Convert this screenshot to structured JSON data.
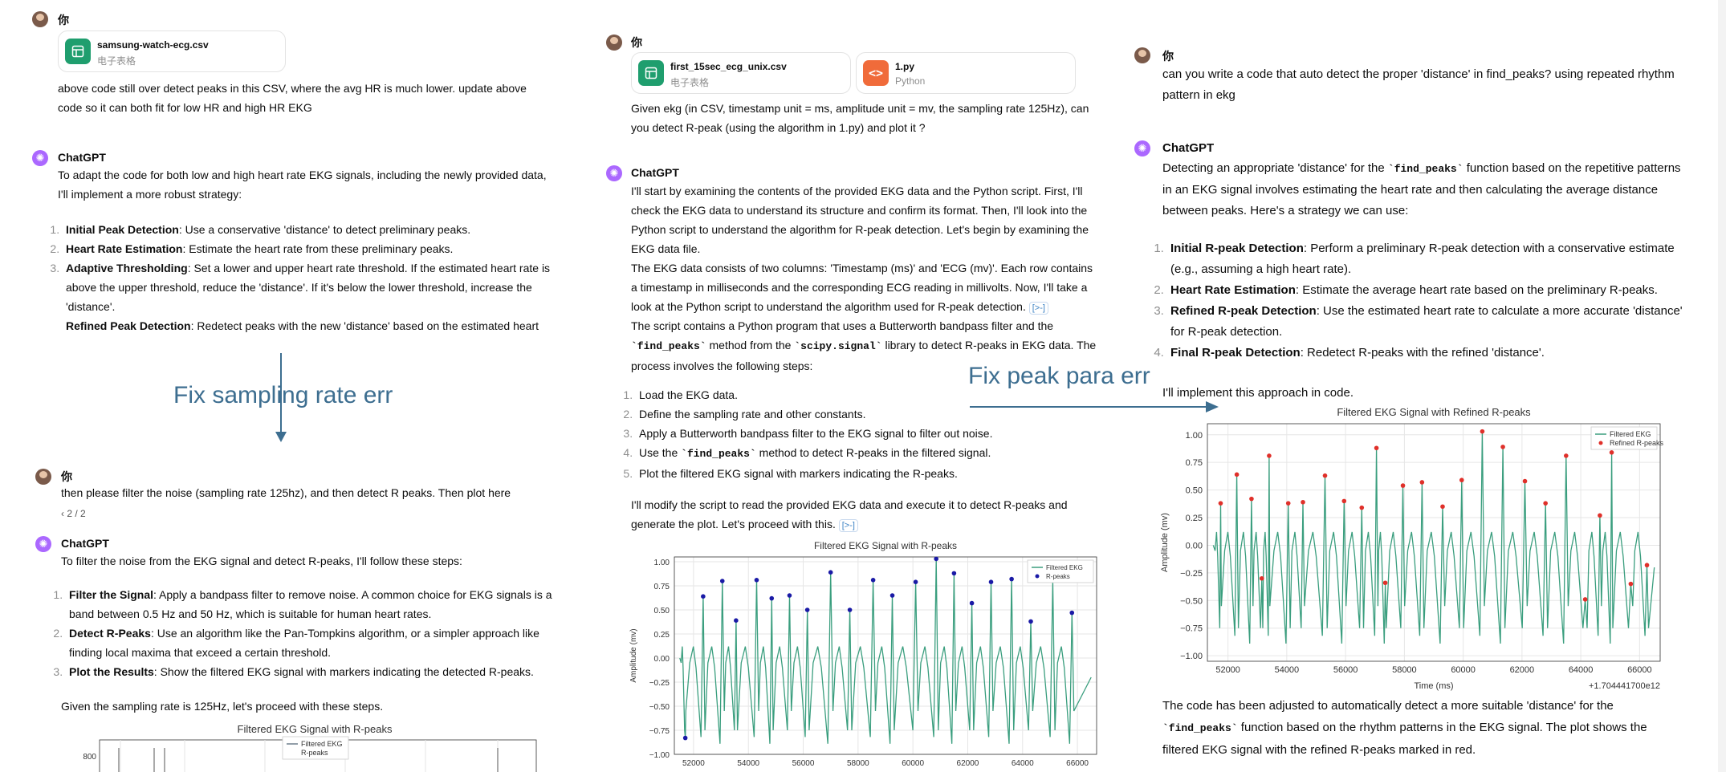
{
  "col1": {
    "user1_name": "你",
    "file1": {
      "name": "samsung-watch-ecg.csv",
      "type": "电子表格",
      "icon": "spreadsheet-icon",
      "color": "#1f9e6e"
    },
    "user1_text": "above code still over detect peaks in this CSV, where the avg HR is much lower. update above code so it can both fit for low HR and high HR EKG",
    "gpt1_name": "ChatGPT",
    "gpt1_intro": "To adapt the code for both low and high heart rate EKG signals, including the newly provided data, I'll implement a more robust strategy:",
    "gpt1_steps": [
      {
        "title": "Initial Peak Detection",
        "text": ": Use a conservative 'distance' to detect preliminary peaks."
      },
      {
        "title": "Heart Rate Estimation",
        "text": ": Estimate the heart rate from these preliminary peaks."
      },
      {
        "title": "Adaptive Thresholding",
        "text": ": Set a lower and upper heart rate threshold. If the estimated heart rate is above the upper threshold, reduce the 'distance'. If it's below the lower threshold, increase the 'distance'."
      },
      {
        "title": "Refined Peak Detection",
        "text": ": Redetect peaks with the new 'distance' based on the estimated heart rate."
      }
    ],
    "user2_name": "你",
    "user2_text": "then please filter the noise (sampling rate 125hz), and then detect R peaks. Then plot here",
    "pager": "2 / 2",
    "gpt2_name": "ChatGPT",
    "gpt2_intro": "To filter the noise from the EKG signal and detect R-peaks, I'll follow these steps:",
    "gpt2_steps": [
      {
        "title": "Filter the Signal",
        "text": ": Apply a bandpass filter to remove noise. A common choice for EKG signals is a band between 0.5 Hz and 50 Hz, which is suitable for human heart rates."
      },
      {
        "title": "Detect R-Peaks",
        "text": ": Use an algorithm like the Pan-Tompkins algorithm, or a simpler approach like finding local maxima that exceed a certain threshold."
      },
      {
        "title": "Plot the Results",
        "text": ": Show the filtered EKG signal with markers indicating the detected R-peaks."
      }
    ],
    "gpt2_outro": "Given the sampling rate is 125Hz, let's proceed with these steps."
  },
  "col2": {
    "user_name": "你",
    "file1": {
      "name": "first_15sec_ecg_unix.csv",
      "type": "电子表格",
      "icon": "spreadsheet-icon",
      "color": "#1f9e6e"
    },
    "file2": {
      "name": "1.py",
      "type": "Python",
      "icon": "code-icon",
      "color": "#f06b3a"
    },
    "user_text": "Given ekg (in CSV, timestamp unit = ms, amplitude unit = mv, the sampling rate 125Hz), can you detect R-peak (using the algorithm in 1.py) and plot it ?",
    "gpt_name": "ChatGPT",
    "para1": "I'll start by examining the contents of the provided EKG data and the Python script. First, I'll check the EKG data to understand its structure and confirm its format. Then, I'll look into the Python script to understand the algorithm for R-peak detection. Let's begin by examining the EKG data file.",
    "para2": "The EKG data consists of two columns: 'Timestamp (ms)' and 'ECG (mv)'. Each row contains a timestamp in milliseconds and the corresponding ECG reading in millivolts. Now, I'll take a look at the Python script to understand the algorithm used for R-peak detection.",
    "link_badge": "[>-]",
    "para3_a": "The script contains a Python program that uses a Butterworth bandpass filter and the",
    "para3_code1": "`find_peaks`",
    "para3_b": " method from the ",
    "para3_code2": "`scipy.signal`",
    "para3_c": " library to detect R-peaks in EKG data. The process involves the following steps:",
    "steps": [
      {
        "a": "Load the EKG data.",
        "code": "",
        "b": ""
      },
      {
        "a": "Define the sampling rate and other constants.",
        "code": "",
        "b": ""
      },
      {
        "a": "Apply a Butterworth bandpass filter to the EKG signal to filter out noise.",
        "code": "",
        "b": ""
      },
      {
        "a": "Use the ",
        "code": "`find_peaks`",
        "b": " method to detect R-peaks in the filtered signal."
      },
      {
        "a": "Plot the filtered EKG signal with markers indicating the R-peaks.",
        "code": "",
        "b": ""
      }
    ],
    "para4": "I'll modify the script to read the provided EKG data and execute it to detect R-peaks and generate the plot. Let's proceed with this."
  },
  "col3": {
    "user_name": "你",
    "user_text": "can you write a code that auto detect the proper 'distance' in find_peaks? using repeated rhythm pattern in ekg",
    "gpt_name": "ChatGPT",
    "intro_a": "Detecting an appropriate 'distance' for the ",
    "intro_code": "`find_peaks`",
    "intro_b": " function based on the repetitive patterns in an EKG signal involves estimating the heart rate and then calculating the average distance between peaks. Here's a strategy we can use:",
    "steps": [
      {
        "title": "Initial R-peak Detection",
        "text": ": Perform a preliminary R-peak detection with a conservative estimate (e.g., assuming a high heart rate)."
      },
      {
        "title": "Heart Rate Estimation",
        "text": ": Estimate the average heart rate based on the preliminary R-peaks."
      },
      {
        "title": "Refined R-peak Detection",
        "text": ": Use the estimated heart rate to calculate a more accurate 'distance' for R-peak detection."
      },
      {
        "title": "Final R-peak Detection",
        "text": ": Redetect R-peaks with the refined 'distance'."
      }
    ],
    "implement": "I'll implement this approach in code.",
    "outro_a": "The code has been adjusted to automatically detect a more suitable 'distance' for the ",
    "outro_code": "`find_peaks`",
    "outro_b": " function based on the rhythm patterns in the EKG signal. The plot shows the filtered EKG signal with the refined R-peaks marked in red."
  },
  "annotations": {
    "fix_sampling": "Fix sampling rate err",
    "fix_peak": "Fix peak para err"
  },
  "colors": {
    "accent_blue": "#3d6e90",
    "signal": "#3a9e7e",
    "peak_blue": "#1a1aa6",
    "peak_red": "#e0302a",
    "gpt_purple": "#ab68ff"
  },
  "chart_data": [
    {
      "type": "line",
      "title": "Filtered EKG Signal with R-peaks",
      "ylabel": "",
      "y_tick_labels": [
        "800"
      ],
      "legend": [
        "Filtered EKG",
        "R-peaks"
      ],
      "legend_position": "top-center",
      "note": "partially visible (cut off at bottom)"
    },
    {
      "type": "line",
      "title": "Filtered EKG Signal with R-peaks",
      "xlabel": "",
      "ylabel": "Amplitude (mv)",
      "xlim": [
        51300,
        66700
      ],
      "ylim": [
        -1.0,
        1.05
      ],
      "x_ticks": [
        "52000",
        "54000",
        "56000",
        "58000",
        "60000",
        "62000",
        "64000",
        "66000"
      ],
      "y_ticks": [
        "1.00",
        "0.75",
        "0.50",
        "0.25",
        "0.00",
        "−0.25",
        "−0.50",
        "−0.75",
        "−1.00"
      ],
      "legend": [
        "Filtered EKG",
        "R-peaks"
      ],
      "legend_position": "top-right",
      "peak_color": "blue",
      "peaks": {
        "x": [
          51700,
          52350,
          53050,
          53550,
          54300,
          54850,
          55500,
          56150,
          57000,
          57700,
          58550,
          59250,
          60100,
          60850,
          61500,
          62150,
          62850,
          63600,
          64300,
          65100,
          65800
        ],
        "y": [
          -0.83,
          0.64,
          0.8,
          0.39,
          0.81,
          0.62,
          0.65,
          0.5,
          0.89,
          0.5,
          0.81,
          0.65,
          0.79,
          1.03,
          0.88,
          0.57,
          0.79,
          0.82,
          0.38,
          0.81,
          0.47
        ]
      }
    },
    {
      "type": "line",
      "title": "Filtered EKG Signal with Refined R-peaks",
      "xlabel": "Time (ms)",
      "ylabel": "Amplitude (mv)",
      "offset_label": "+1.704441700e12",
      "xlim": [
        51300,
        66700
      ],
      "ylim": [
        -1.05,
        1.1
      ],
      "x_ticks": [
        "52000",
        "54000",
        "56000",
        "58000",
        "60000",
        "62000",
        "64000",
        "66000"
      ],
      "y_ticks": [
        "1.00",
        "0.75",
        "0.50",
        "0.25",
        "0.00",
        "−0.25",
        "−0.50",
        "−0.75",
        "−1.00"
      ],
      "legend": [
        "Filtered EKG",
        "Refined R-peaks"
      ],
      "legend_position": "top-right",
      "peak_color": "red",
      "peaks": {
        "x": [
          51750,
          52300,
          52800,
          53150,
          53400,
          54050,
          54550,
          55300,
          55950,
          56550,
          57050,
          57350,
          57950,
          58600,
          59300,
          59950,
          60650,
          61350,
          62100,
          62800,
          63500,
          64150,
          64650,
          65050,
          65700,
          66250
        ],
        "y": [
          0.38,
          0.64,
          0.42,
          -0.3,
          0.81,
          0.38,
          0.39,
          0.63,
          0.4,
          0.34,
          0.88,
          -0.34,
          0.54,
          0.57,
          0.35,
          0.59,
          1.03,
          0.89,
          0.58,
          0.38,
          0.81,
          -0.49,
          0.27,
          0.84,
          -0.35,
          -0.18
        ]
      }
    }
  ]
}
